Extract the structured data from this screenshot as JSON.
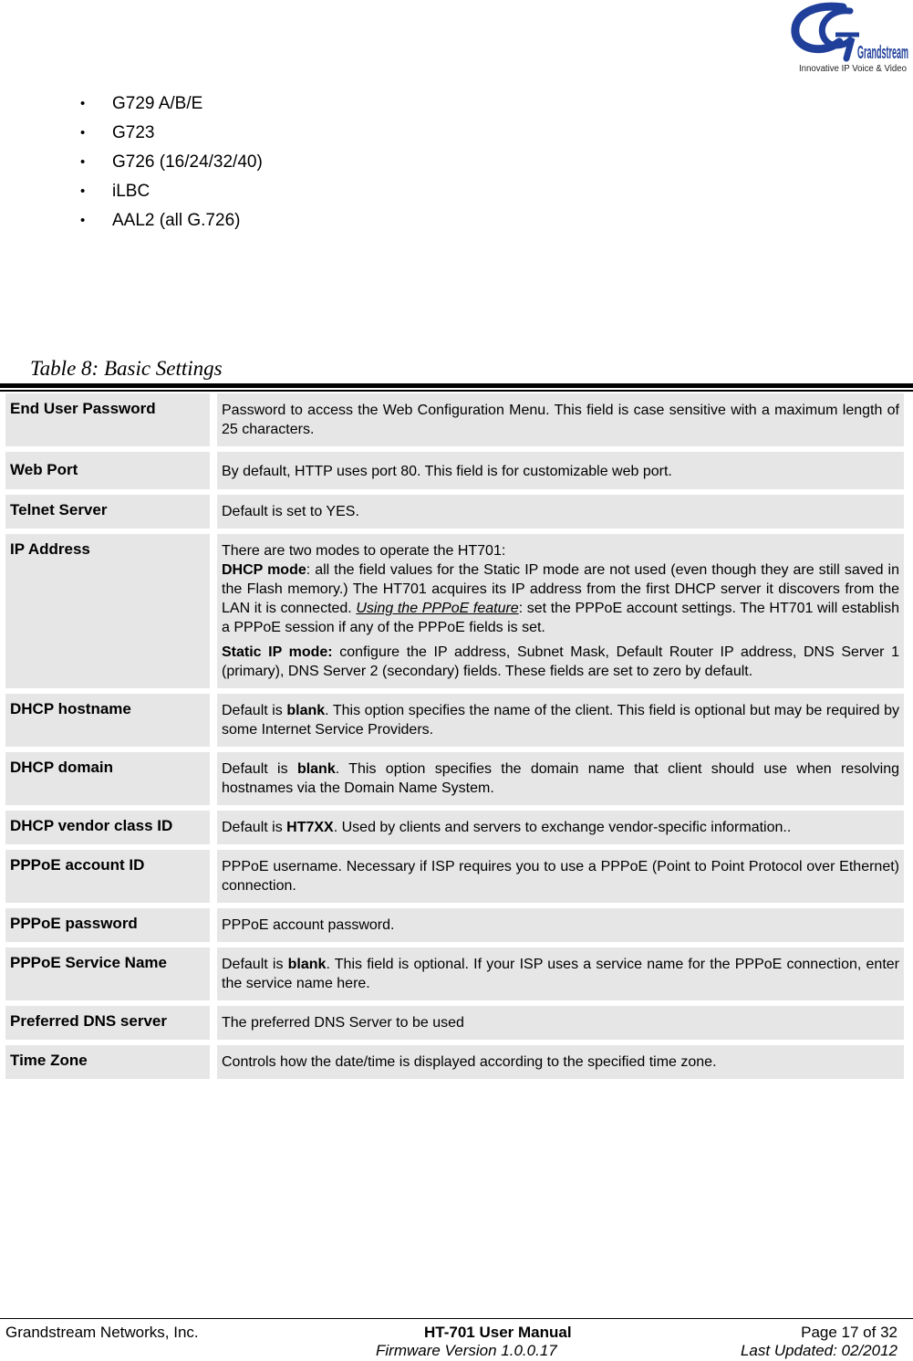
{
  "logo": {
    "brand": "Grandstream",
    "tagline": "Innovative IP Voice & Video",
    "color": "#1f3f9a"
  },
  "codec_list": [
    "G729 A/B/E",
    "G723",
    "G726 (16/24/32/40)",
    "iLBC",
    "AAL2 (all G.726)"
  ],
  "table": {
    "caption": "Table 8:  Basic Settings",
    "cell_bg": "#e6e6e6",
    "rows": [
      {
        "name": "End User Password",
        "desc": [
          {
            "t": "Password to access the Web Configuration Menu. This field is case sensitive with a maximum length of 25 characters."
          }
        ]
      },
      {
        "name": "Web Port",
        "desc": [
          {
            "t": "By default, HTTP uses port 80.  This field is for customizable web port."
          }
        ]
      },
      {
        "name": "Telnet Server",
        "desc": [
          {
            "t": "Default is set to YES."
          }
        ]
      },
      {
        "name": "IP Address",
        "intro": "There are two modes to operate the HT701:",
        "dhcp_label": "DHCP mode",
        "dhcp_text": ": all the field values for the Static IP mode are not used (even though they are still saved in the Flash memory.) The HT701 acquires its IP address from the first DHCP server it discovers from the LAN it is connected.  ",
        "pppoe_link": "Using the PPPoE feature",
        "pppoe_text": ": set the PPPoE account settings. The HT701 will establish a PPPoE session if any of the PPPoE fields is set.",
        "static_label": "Static IP mode:",
        "static_text": "  configure the IP address, Subnet Mask, Default Router IP address, DNS Server 1 (primary), DNS Server 2 (secondary) fields. These fields are set to zero by default."
      },
      {
        "name": "DHCP hostname",
        "pre": "Default is ",
        "bold": "blank",
        "post": ". This option specifies the name of the client. This field is optional but may be required by some Internet Service Providers."
      },
      {
        "name": "DHCP domain",
        "pre": "Default is ",
        "bold": "blank",
        "post": ". This option specifies the domain name that client should use when resolving hostnames via the Domain Name System."
      },
      {
        "name": "DHCP vendor class ID",
        "pre": "Default is ",
        "bold": "HT7XX",
        "post": ". Used by clients and servers to exchange vendor-specific information.."
      },
      {
        "name": "PPPoE account ID",
        "pre": "PPPoE username. Necessary if ISP requires you to use a PPPoE (Point to Point Protocol over Ethernet) connection.",
        "bold": "",
        "post": ""
      },
      {
        "name": "PPPoE password",
        "pre": "PPPoE account password.",
        "bold": "",
        "post": ""
      },
      {
        "name": "PPPoE Service Name",
        "pre": "Default is ",
        "bold": "blank",
        "post": ". This field is optional. If your ISP uses a service name for the PPPoE connection, enter the service name here."
      },
      {
        "name": "Preferred DNS server",
        "pre": "The preferred  DNS Server to be used",
        "bold": "",
        "post": ""
      },
      {
        "name": "Time Zone",
        "pre": "Controls how the date/time is displayed according to the specified time zone.",
        "bold": "",
        "post": ""
      }
    ]
  },
  "footer": {
    "company": "Grandstream Networks, Inc.",
    "manual_title": "HT-701 User Manual",
    "firmware": "Firmware Version 1.0.0.17",
    "page": "Page 17 of 32",
    "last_updated": "Last Updated: 02/2012"
  }
}
